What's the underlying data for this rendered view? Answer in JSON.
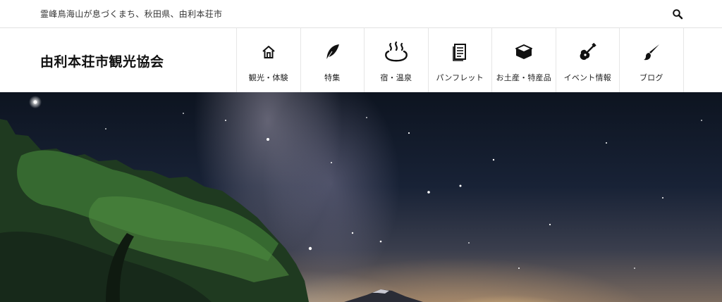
{
  "topbar": {
    "tagline": "霊峰鳥海山が息づくまち、秋田県、由利本荘市",
    "search_icon": "search-icon"
  },
  "header": {
    "site_title": "由利本荘市観光協会"
  },
  "nav": {
    "items": [
      {
        "label": "観光・体験",
        "icon": "home-icon"
      },
      {
        "label": "特集",
        "icon": "feather-icon"
      },
      {
        "label": "宿・温泉",
        "icon": "hot-spring-icon"
      },
      {
        "label": "パンフレット",
        "icon": "document-icon"
      },
      {
        "label": "お土産・特産品",
        "icon": "box-icon"
      },
      {
        "label": "イベント情報",
        "icon": "guitar-icon"
      },
      {
        "label": "ブログ",
        "icon": "brush-icon"
      }
    ]
  },
  "colors": {
    "text": "#222222",
    "border": "#e6e6e6",
    "sky_top": "#0d1420",
    "horizon_glow": "#ffd68c",
    "tree_green": "#2f5a2c"
  }
}
